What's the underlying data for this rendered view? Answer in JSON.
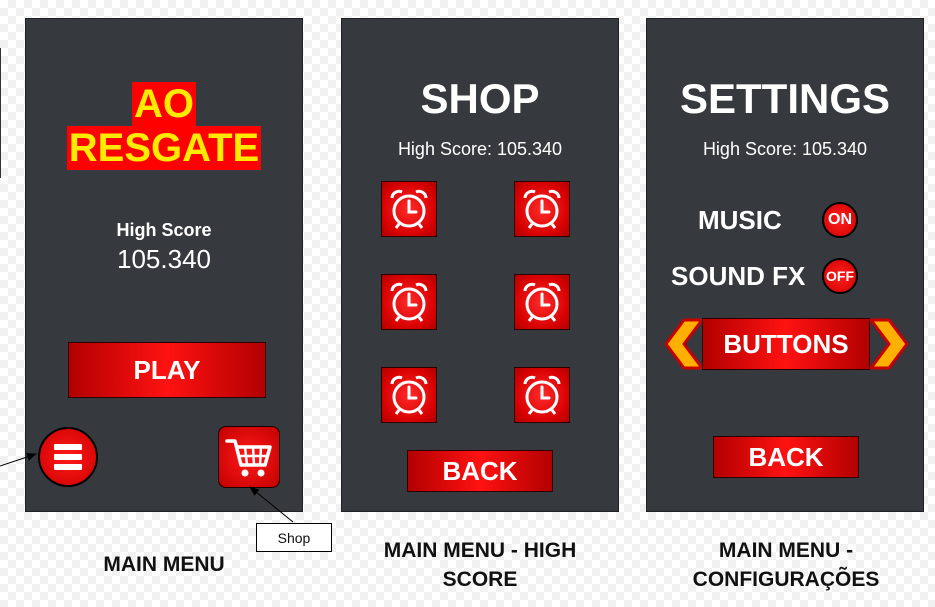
{
  "main_menu": {
    "title_line1": "AO",
    "title_line2": "RESGATE",
    "high_score_label": "High Score",
    "high_score_value": "105.340",
    "play_label": "PLAY",
    "menu_icon": "hamburger-menu-icon",
    "cart_icon": "shopping-cart-icon"
  },
  "shop": {
    "title": "SHOP",
    "high_score": "High Score: 105.340",
    "item_icon": "alarm-clock-icon",
    "back_label": "BACK"
  },
  "settings": {
    "title": "SETTINGS",
    "high_score": "High Score: 105.340",
    "music_label": "MUSIC",
    "music_state": "ON",
    "sound_label": "SOUND FX",
    "sound_state": "OFF",
    "buttons_label": "BUTTONS",
    "back_label": "BACK"
  },
  "annotation": {
    "shop_label": "Shop"
  },
  "captions": {
    "main_menu": "MAIN MENU",
    "high_score_line1": "MAIN MENU - HIGH",
    "high_score_line2": "SCORE",
    "config_line1": "MAIN MENU -",
    "config_line2": "CONFIGURAÇÕES"
  },
  "colors": {
    "panel": "#36393d",
    "button_red": "#ff1212",
    "title_yellow": "#ffeb00",
    "arrow_orange": "#ffb000"
  }
}
